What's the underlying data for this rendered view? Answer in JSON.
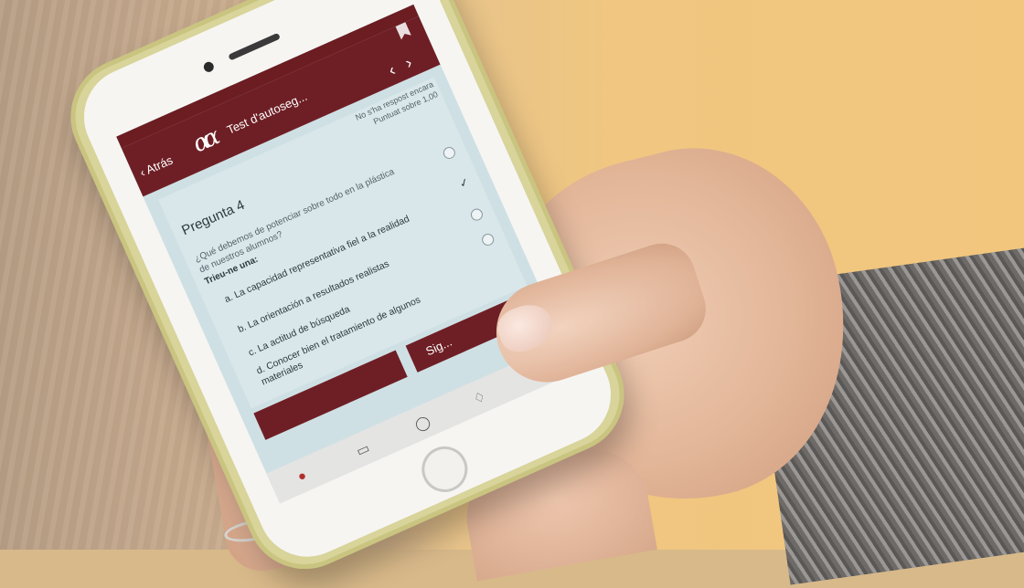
{
  "header": {
    "back_label": "Atrás",
    "title": "Test d'autoseg...",
    "nav": "‹ ›",
    "icons": [
      "back-chevron-icon",
      "logo-icon",
      "chevron-left-icon",
      "chevron-right-icon",
      "bookmark-icon"
    ]
  },
  "quiz": {
    "status_line1": "No s'ha respost encara",
    "status_line2": "Puntuat sobre 1,00",
    "question_label": "Pregunta 4",
    "question_text": "¿Qué debemos de potenciar sobre todo en la plástica de nuestros alumnos?",
    "instruction": "Trieu-ne una:",
    "options": [
      {
        "text": "a. La capacidad representativa fiel a la realidad",
        "selected": false
      },
      {
        "text": "b. La orientación a resultados realistas",
        "selected": false
      },
      {
        "text": "c. La actitud de búsqueda",
        "selected": false
      },
      {
        "text": "d. Conocer bien el tratamiento de algunos materiales",
        "selected": false
      }
    ],
    "next_label": "Sig..."
  },
  "tabbar": {
    "icons": [
      "home-icon",
      "calendar-icon",
      "chat-icon",
      "bell-icon",
      "more-icon"
    ]
  },
  "colors": {
    "brand": "#6e1f25",
    "screen_bg": "#cfe0e4",
    "case": "#d8d49a"
  }
}
